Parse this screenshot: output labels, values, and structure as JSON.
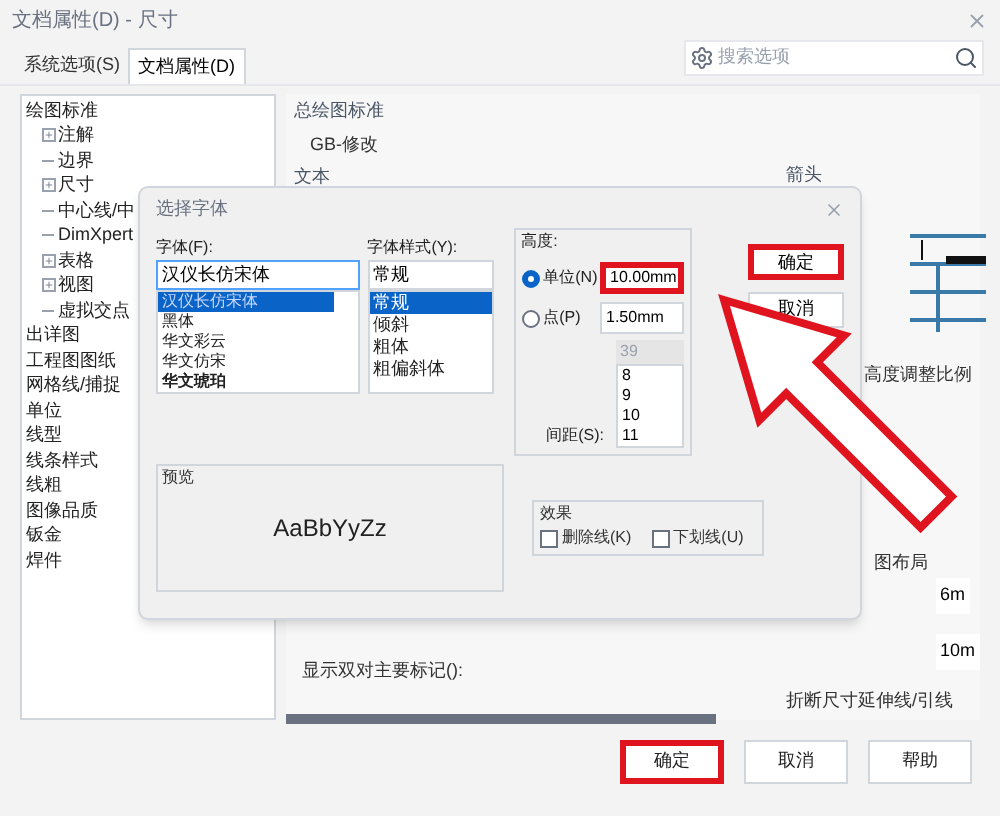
{
  "window": {
    "title": "文档属性(D) - 尺寸"
  },
  "tabs": [
    {
      "label": "系统选项(S)",
      "selected": false
    },
    {
      "label": "文档属性(D)",
      "selected": true
    }
  ],
  "search": {
    "placeholder": "搜索选项"
  },
  "tree": [
    {
      "label": "绘图标准",
      "children": [
        {
          "label": "注解",
          "expanded": false
        },
        {
          "label": "边界"
        },
        {
          "label": "尺寸",
          "expanded": false
        },
        {
          "label": "中心线/中"
        },
        {
          "label": "DimXpert"
        },
        {
          "label": "表格",
          "expanded": false
        },
        {
          "label": "视图",
          "expanded": false
        },
        {
          "label": "虚拟交点"
        }
      ]
    },
    {
      "label": "出详图"
    },
    {
      "label": "工程图图纸"
    },
    {
      "label": "网格线/捕捉"
    },
    {
      "label": "单位"
    },
    {
      "label": "线型"
    },
    {
      "label": "线条样式"
    },
    {
      "label": "线粗"
    },
    {
      "label": "图像品质"
    },
    {
      "label": "钣金"
    },
    {
      "label": "焊件"
    }
  ],
  "settings": {
    "standard_heading": "总绘图标准",
    "standard_value": "GB-修改",
    "text_heading": "文本",
    "arrows_heading": "箭头",
    "scale_label": "高度调整比例",
    "layout_label": "图布局",
    "offset_values": [
      "6m",
      "10m"
    ],
    "dual_label": "显示双对主要标记():",
    "break_label": "折断尺寸延伸线/引线"
  },
  "font_dialog": {
    "title": "选择字体",
    "font_label": "字体(F):",
    "font_value": "汉仪长仿宋体",
    "fonts": [
      {
        "label": "汉仪长仿宋体",
        "selected": true
      },
      {
        "label": "黑体",
        "selected": false
      },
      {
        "label": "华文彩云",
        "selected": false
      },
      {
        "label": "华文仿宋",
        "selected": false
      },
      {
        "label": "华文琥珀",
        "selected": false
      }
    ],
    "style_label": "字体样式(Y):",
    "style_value": "常规",
    "styles": [
      {
        "label": "常规",
        "selected": true
      },
      {
        "label": "倾斜",
        "selected": false
      },
      {
        "label": "粗体",
        "selected": false
      },
      {
        "label": "粗偏斜体",
        "selected": false
      }
    ],
    "height_label": "高度:",
    "units": [
      {
        "label": "单位(N)",
        "selected": true,
        "value": "10.00mm",
        "highlighted": true
      },
      {
        "label": "点(P)",
        "selected": false,
        "value": "1.50mm",
        "highlighted": false
      }
    ],
    "size_value": "39",
    "sizes": [
      "8",
      "9",
      "10",
      "11"
    ],
    "spacing_label": "间距(S):",
    "preview_label": "预览",
    "preview_text": "AaBbYyZz",
    "effects_label": "效果",
    "effects": [
      {
        "label": "删除线(K)",
        "checked": false
      },
      {
        "label": "下划线(U)",
        "checked": false
      }
    ],
    "buttons": [
      {
        "label": "确定",
        "highlighted": true
      },
      {
        "label": "取消",
        "highlighted": false
      }
    ]
  },
  "footer_buttons": [
    {
      "label": "确定",
      "highlighted": true
    },
    {
      "label": "取消",
      "highlighted": false
    },
    {
      "label": "帮助",
      "highlighted": false
    }
  ]
}
